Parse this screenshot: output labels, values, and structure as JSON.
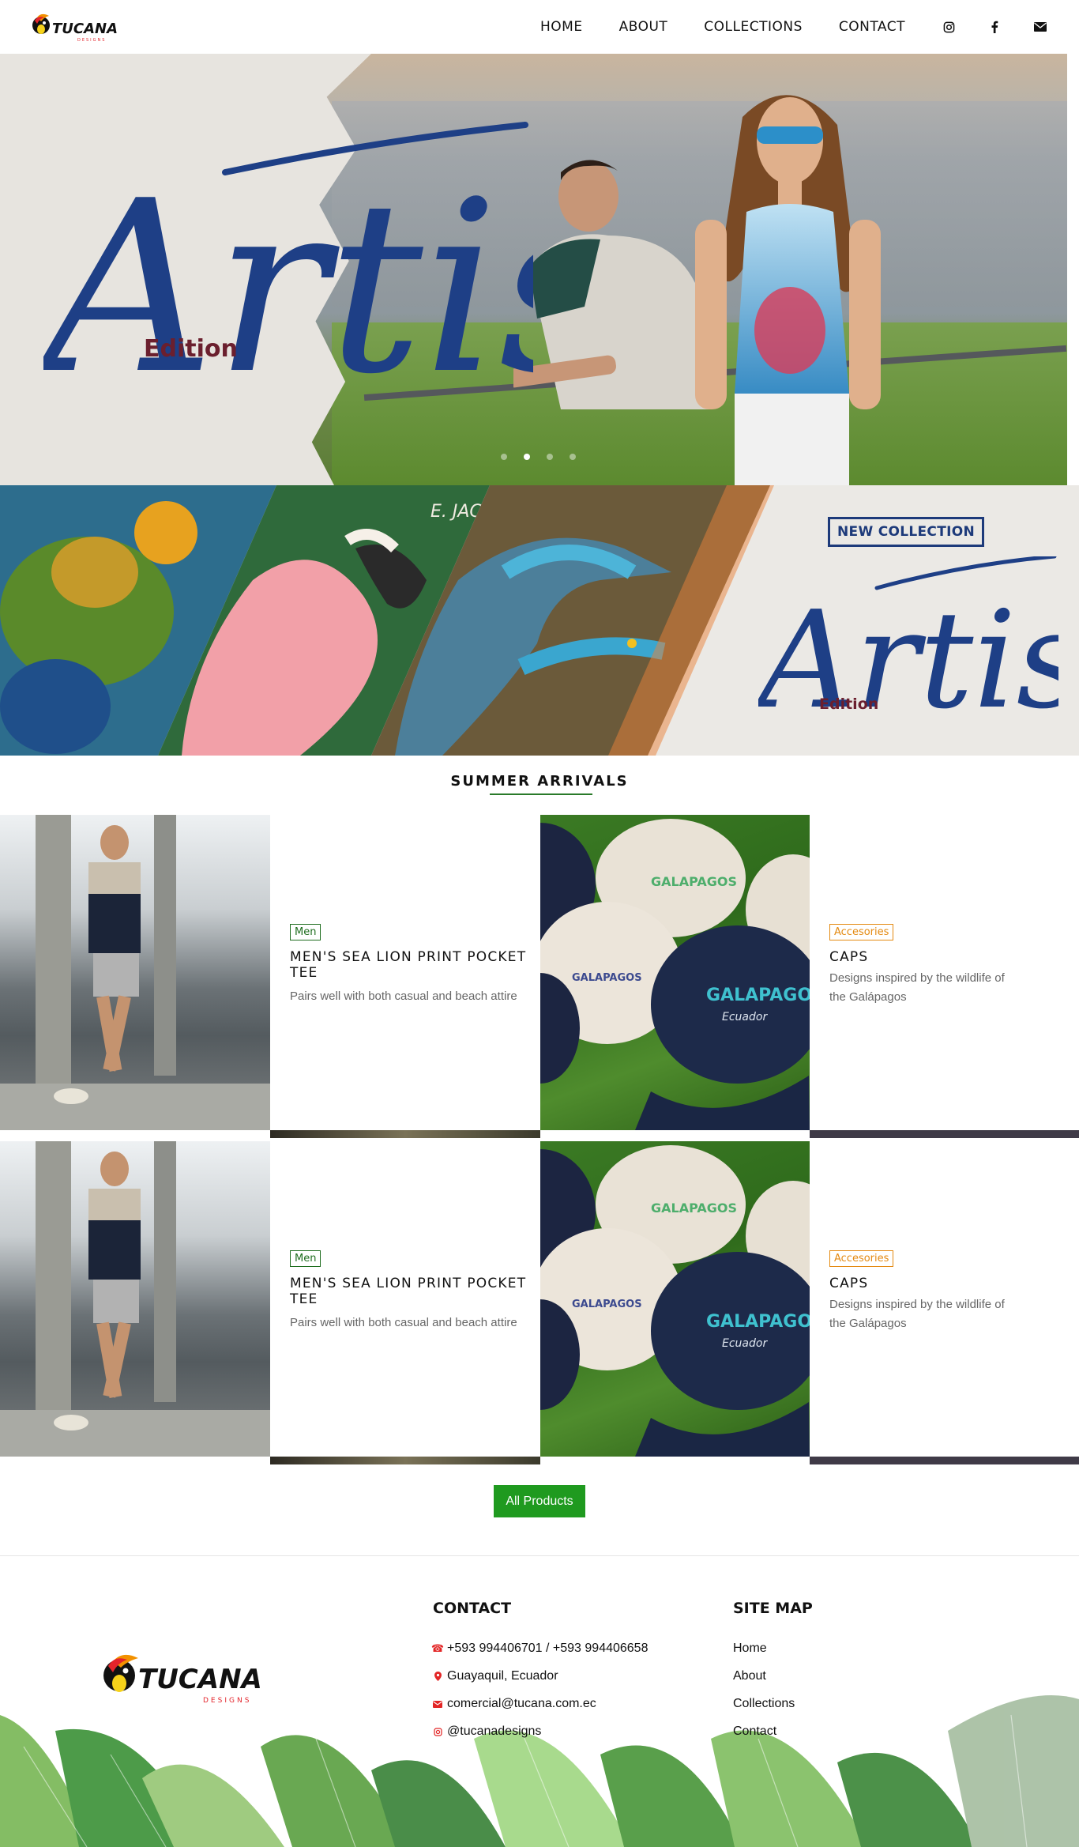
{
  "nav": {
    "logo_text": "TUCANA",
    "logo_sub": "DESIGNS",
    "links": [
      "HOME",
      "ABOUT",
      "COLLECTIONS",
      "CONTACT"
    ],
    "icons": [
      "instagram-icon",
      "facebook-icon",
      "envelope-icon"
    ]
  },
  "hero": {
    "script": "Artist",
    "edition": "Edition",
    "slide_count": 4,
    "active_slide": 2
  },
  "banner": {
    "badge": "NEW COLLECTION",
    "script": "Artist",
    "edition": "Edition",
    "signature": "E. JACOME"
  },
  "section": {
    "title": "SUMMER ARRIVALS"
  },
  "products": [
    {
      "tag": "Men",
      "title_line1": "MEN'S SEA LION PRINT POCKET",
      "title_line2": "TEE",
      "desc": "Pairs well with both casual and beach attire"
    },
    {
      "tag": "Accesories",
      "title_line1": "CAPS",
      "title_line2": "",
      "desc_line1": "Designs inspired by the wildlife of",
      "desc_line2": "the Galápagos"
    }
  ],
  "button": {
    "all_products": "All Products"
  },
  "footer": {
    "contact_heading": "CONTACT",
    "phone": "+593 994406701 / +593 994406658",
    "location": "Guayaquil, Ecuador",
    "email": "comercial@tucana.com.ec",
    "instagram": "@tucanadesigns",
    "sitemap_heading": "SITE MAP",
    "sitemap": [
      "Home",
      "About",
      "Collections",
      "Contact"
    ]
  },
  "colors": {
    "accent_green": "#1f9a1f",
    "tag_green": "#1e6d1e",
    "tag_orange": "#e48a12",
    "brand_blue": "#1d3a7a",
    "edition_maroon": "#6b1f2e",
    "contact_icon_red": "#e32626"
  }
}
